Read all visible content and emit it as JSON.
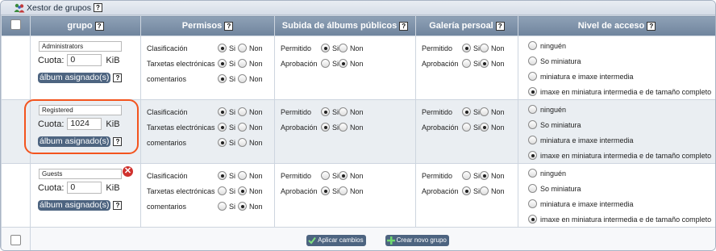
{
  "title": "Xestor de grupos",
  "help_glyph": "?",
  "headers": {
    "group": "grupo",
    "permissions": "Permisos",
    "public_upload": "Subida de álbums públicos",
    "personal_gallery": "Galería persoal",
    "access_level": "Nivel de acceso"
  },
  "labels": {
    "quota": "Cuota:",
    "kib": "KiB",
    "album_assigned": "álbum asignado(s)",
    "yes": "Si",
    "no": "Non",
    "classification": "Clasificación",
    "ecards": "Tarxetas electrónicas",
    "comments": "comentarios",
    "allowed": "Permitido",
    "approval": "Aprobación"
  },
  "access_options": [
    "ninguén",
    "So miniatura",
    "miniatura e imaxe intermedia",
    "imaxe en miniatura intermedia e de tamaño completo"
  ],
  "groups": [
    {
      "name": "Administrators",
      "quota": "0",
      "permissions": {
        "classification": "si",
        "ecards": "si",
        "comments": "si"
      },
      "public_upload": {
        "allowed": "si",
        "approval": "non"
      },
      "personal_gallery": {
        "allowed": "si",
        "approval": "non"
      },
      "access_level": 3,
      "deletable": false
    },
    {
      "name": "Registered",
      "quota": "1024",
      "permissions": {
        "classification": "si",
        "ecards": "si",
        "comments": "si"
      },
      "public_upload": {
        "allowed": "si",
        "approval": "si"
      },
      "personal_gallery": {
        "allowed": "si",
        "approval": "non"
      },
      "access_level": 3,
      "deletable": false,
      "highlighted": true
    },
    {
      "name": "Guests",
      "quota": "0",
      "permissions": {
        "classification": "si",
        "ecards": "non",
        "comments": "non"
      },
      "public_upload": {
        "allowed": "non",
        "approval": "si"
      },
      "personal_gallery": {
        "allowed": "non",
        "approval": "si"
      },
      "access_level": 3,
      "deletable": true
    }
  ],
  "buttons": {
    "apply": "Aplicar cambios",
    "create": "Crear novo grupo"
  },
  "colors": {
    "header": "#7a8ea6",
    "button": "#4d6480",
    "highlight": "#f3541e",
    "delete": "#d0312d"
  }
}
